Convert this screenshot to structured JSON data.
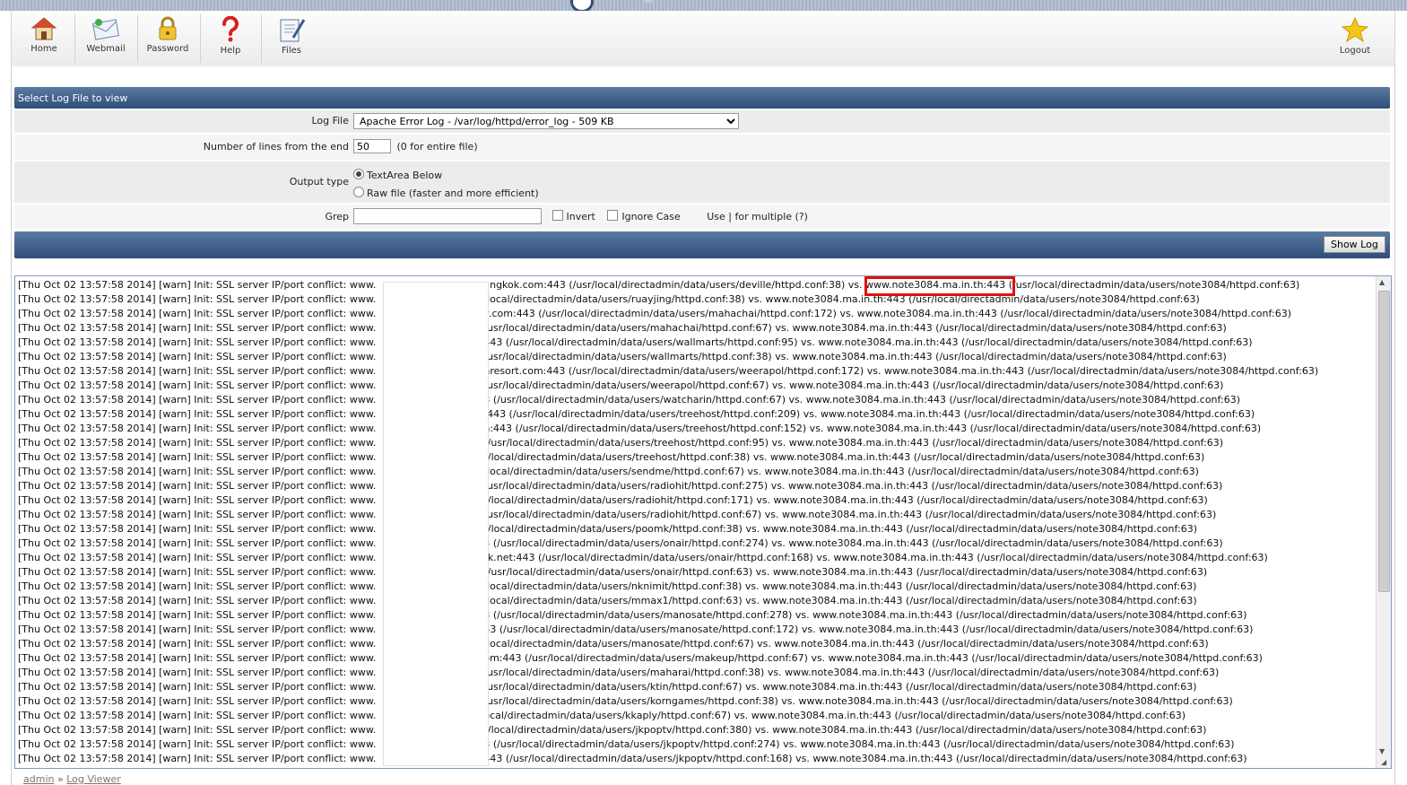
{
  "toolbar": {
    "items": [
      {
        "label": "Home",
        "icon": "home-icon"
      },
      {
        "label": "Webmail",
        "icon": "webmail-icon"
      },
      {
        "label": "Password",
        "icon": "lock-icon"
      },
      {
        "label": "Help",
        "icon": "help-icon"
      },
      {
        "label": "Files",
        "icon": "files-icon"
      }
    ],
    "logout": {
      "label": "Logout",
      "icon": "star-icon"
    }
  },
  "form": {
    "section_title": "Select Log File to view",
    "log_file_label": "Log File",
    "log_file_value": "Apache Error Log - /var/log/httpd/error_log - 509 KB",
    "lines_label": "Number of lines from the end",
    "lines_value": "50",
    "lines_hint": "(0 for entire file)",
    "output_label": "Output type",
    "output_opt1": "TextArea Below",
    "output_opt2": "Raw file (faster and more efficient)",
    "grep_label": "Grep",
    "grep_value": "",
    "invert_label": "Invert",
    "ignore_case_label": "Ignore Case",
    "grep_hint": "Use | for multiple (?)",
    "show_log_button": "Show Log"
  },
  "log": {
    "prefix": "[Thu Oct 02 13:57:58 2014] [warn] Init: SSL server IP/port conflict: www.",
    "lines": [
      "angkok.com:443 (/usr/local/directadmin/data/users/deville/httpd.conf:38) vs. www.note3084.ma.in.th:443 (/usr/local/directadmin/data/users/note3084/httpd.conf:63)",
      "/local/directadmin/data/users/ruayjing/httpd.conf:38) vs. www.note3084.ma.in.th:443 (/usr/local/directadmin/data/users/note3084/httpd.conf:63)",
      "v.com:443 (/usr/local/directadmin/data/users/mahachai/httpd.conf:172) vs. www.note3084.ma.in.th:443 (/usr/local/directadmin/data/users/note3084/httpd.conf:63)",
      "/usr/local/directadmin/data/users/mahachai/httpd.conf:67) vs. www.note3084.ma.in.th:443 (/usr/local/directadmin/data/users/note3084/httpd.conf:63)",
      "443 (/usr/local/directadmin/data/users/wallmarts/httpd.conf:95) vs. www.note3084.ma.in.th:443 (/usr/local/directadmin/data/users/note3084/httpd.conf:63)",
      "/usr/local/directadmin/data/users/wallmarts/httpd.conf:38) vs. www.note3084.ma.in.th:443 (/usr/local/directadmin/data/users/note3084/httpd.conf:63)",
      "nresort.com:443 (/usr/local/directadmin/data/users/weerapol/httpd.conf:172) vs. www.note3084.ma.in.th:443 (/usr/local/directadmin/data/users/note3084/httpd.conf:63)",
      "/usr/local/directadmin/data/users/weerapol/httpd.conf:67) vs. www.note3084.ma.in.th:443 (/usr/local/directadmin/data/users/note3084/httpd.conf:63)",
      "3 (/usr/local/directadmin/data/users/watcharin/httpd.conf:67) vs. www.note3084.ma.in.th:443 (/usr/local/directadmin/data/users/note3084/httpd.conf:63)",
      ":443 (/usr/local/directadmin/data/users/treehost/httpd.conf:209) vs. www.note3084.ma.in.th:443 (/usr/local/directadmin/data/users/note3084/httpd.conf:63)",
      "n:443 (/usr/local/directadmin/data/users/treehost/httpd.conf:152) vs. www.note3084.ma.in.th:443 (/usr/local/directadmin/data/users/note3084/httpd.conf:63)",
      "(/usr/local/directadmin/data/users/treehost/httpd.conf:95) vs. www.note3084.ma.in.th:443 (/usr/local/directadmin/data/users/note3084/httpd.conf:63)",
      "r/local/directadmin/data/users/treehost/httpd.conf:38) vs. www.note3084.ma.in.th:443 (/usr/local/directadmin/data/users/note3084/httpd.conf:63)",
      "/local/directadmin/data/users/sendme/httpd.conf:67) vs. www.note3084.ma.in.th:443 (/usr/local/directadmin/data/users/note3084/httpd.conf:63)",
      "/usr/local/directadmin/data/users/radiohit/httpd.conf:275) vs. www.note3084.ma.in.th:443 (/usr/local/directadmin/data/users/note3084/httpd.conf:63)",
      "r/local/directadmin/data/users/radiohit/httpd.conf:171) vs. www.note3084.ma.in.th:443 (/usr/local/directadmin/data/users/note3084/httpd.conf:63)",
      "/usr/local/directadmin/data/users/radiohit/httpd.conf:67) vs. www.note3084.ma.in.th:443 (/usr/local/directadmin/data/users/note3084/httpd.conf:63)",
      "r/local/directadmin/data/users/poomk/httpd.conf:38) vs. www.note3084.ma.in.th:443 (/usr/local/directadmin/data/users/note3084/httpd.conf:63)",
      "3 (/usr/local/directadmin/data/users/onair/httpd.conf:274) vs. www.note3084.ma.in.th:443 (/usr/local/directadmin/data/users/note3084/httpd.conf:63)",
      "rk.net:443 (/usr/local/directadmin/data/users/onair/httpd.conf:168) vs. www.note3084.ma.in.th:443 (/usr/local/directadmin/data/users/note3084/httpd.conf:63)",
      "(/usr/local/directadmin/data/users/onair/httpd.conf:63) vs. www.note3084.ma.in.th:443 (/usr/local/directadmin/data/users/note3084/httpd.conf:63)",
      "/local/directadmin/data/users/nknimit/httpd.conf:38) vs. www.note3084.ma.in.th:443 (/usr/local/directadmin/data/users/note3084/httpd.conf:63)",
      "/local/directadmin/data/users/mmax1/httpd.conf:63) vs. www.note3084.ma.in.th:443 (/usr/local/directadmin/data/users/note3084/httpd.conf:63)",
      "3 (/usr/local/directadmin/data/users/manosate/httpd.conf:278) vs. www.note3084.ma.in.th:443 (/usr/local/directadmin/data/users/note3084/httpd.conf:63)",
      "43 (/usr/local/directadmin/data/users/manosate/httpd.conf:172) vs. www.note3084.ma.in.th:443 (/usr/local/directadmin/data/users/note3084/httpd.conf:63)",
      "/local/directadmin/data/users/manosate/httpd.conf:67) vs. www.note3084.ma.in.th:443 (/usr/local/directadmin/data/users/note3084/httpd.conf:63)",
      "om:443 (/usr/local/directadmin/data/users/makeup/httpd.conf:67) vs. www.note3084.ma.in.th:443 (/usr/local/directadmin/data/users/note3084/httpd.conf:63)",
      "/usr/local/directadmin/data/users/maharai/httpd.conf:38) vs. www.note3084.ma.in.th:443 (/usr/local/directadmin/data/users/note3084/httpd.conf:63)",
      "/usr/local/directadmin/data/users/ktin/httpd.conf:67) vs. www.note3084.ma.in.th:443 (/usr/local/directadmin/data/users/note3084/httpd.conf:63)",
      "/usr/local/directadmin/data/users/korngames/httpd.conf:38) vs. www.note3084.ma.in.th:443 (/usr/local/directadmin/data/users/note3084/httpd.conf:63)",
      "ocal/directadmin/data/users/kkaply/httpd.conf:67) vs. www.note3084.ma.in.th:443 (/usr/local/directadmin/data/users/note3084/httpd.conf:63)",
      "r/local/directadmin/data/users/jkpoptv/httpd.conf:380) vs. www.note3084.ma.in.th:443 (/usr/local/directadmin/data/users/note3084/httpd.conf:63)",
      "3 (/usr/local/directadmin/data/users/jkpoptv/httpd.conf:274) vs. www.note3084.ma.in.th:443 (/usr/local/directadmin/data/users/note3084/httpd.conf:63)",
      "443 (/usr/local/directadmin/data/users/jkpoptv/httpd.conf:168) vs. www.note3084.ma.in.th:443 (/usr/local/directadmin/data/users/note3084/httpd.conf:63)"
    ]
  },
  "breadcrumb": {
    "root": "admin",
    "sep": "»",
    "current": "Log Viewer"
  }
}
